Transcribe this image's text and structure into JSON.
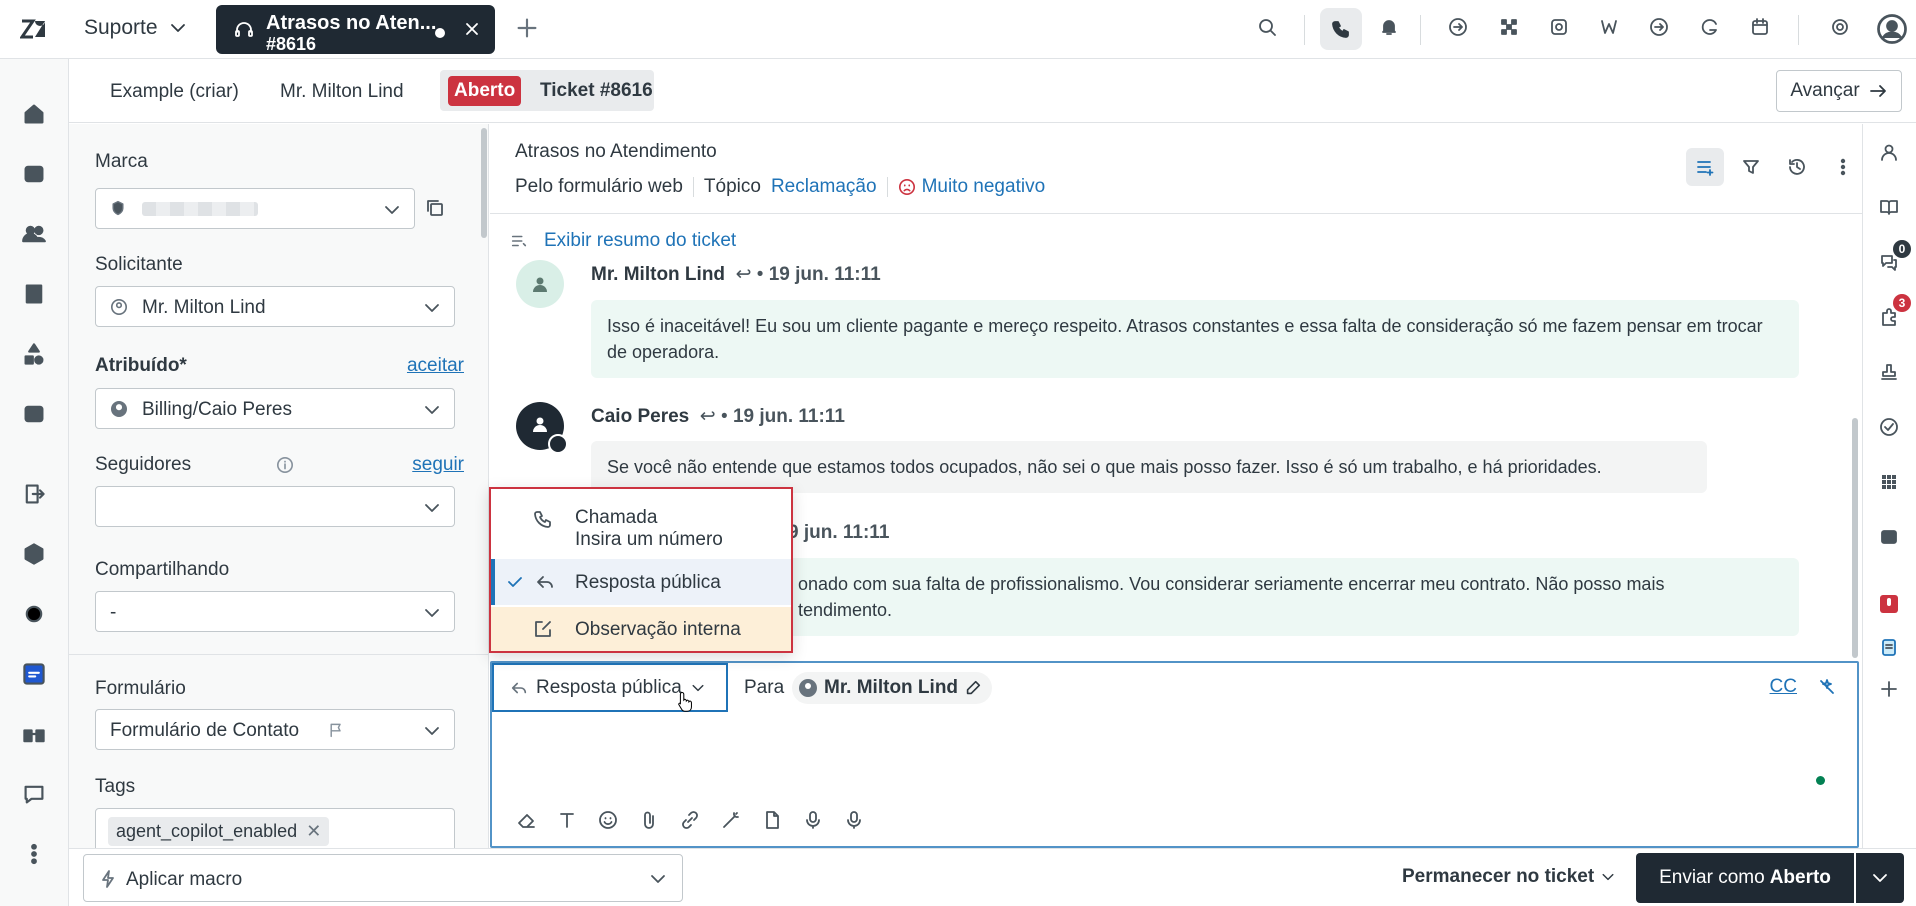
{
  "header": {
    "product": "Suporte",
    "tab": {
      "title": "Atrasos no Aten...",
      "id": "#8616"
    }
  },
  "subheader": {
    "breadcrumbs": [
      "Example (criar)",
      "Mr. Milton Lind"
    ],
    "status_badge": "Aberto",
    "ticket_label": "Ticket #8616",
    "advance_label": "Avançar"
  },
  "properties": {
    "brand_label": "Marca",
    "requester_label": "Solicitante",
    "requester_value": "Mr. Milton Lind",
    "assignee_label": "Atribuído*",
    "assignee_link": "aceitar",
    "assignee_value": "Billing/Caio Peres",
    "followers_label": "Seguidores",
    "followers_link": "seguir",
    "sharing_label": "Compartilhando",
    "sharing_value": "-",
    "form_label": "Formulário",
    "form_value": "Formulário de Contato",
    "tags_label": "Tags",
    "tag": "agent_copilot_enabled"
  },
  "conversation": {
    "title": "Atrasos no Atendimento",
    "via": "Pelo formulário web",
    "topic_label": "Tópico",
    "topic_value": "Reclamação",
    "sentiment": "Muito negativo",
    "summary_link": "Exibir resumo do ticket",
    "messages": [
      {
        "author": "Mr. Milton Lind",
        "time": "19 jun. 11:11",
        "text": "Isso é inaceitável! Eu sou um cliente pagante e mereço respeito. Atrasos constantes e essa falta de consideração só me fazem pensar em trocar de operadora."
      },
      {
        "author": "Caio Peres",
        "time": "19 jun. 11:11",
        "text": "Se você não entende que estamos todos ocupados, não sei o que mais posso fazer. Isso é só um trabalho, e há prioridades."
      },
      {
        "author": "",
        "time": "9 jun. 11:11",
        "text": "onado com sua falta de profissionalismo. Vou considerar seriamente encerrar meu contrato. Não posso mais",
        "text2": "tendimento."
      }
    ]
  },
  "channel_menu": {
    "call_label": "Chamada",
    "call_sub": "Insira um número",
    "public_label": "Resposta pública",
    "internal_label": "Observação interna"
  },
  "composer": {
    "channel": "Resposta pública",
    "to_label": "Para",
    "to_value": "Mr. Milton Lind",
    "cc_label": "CC"
  },
  "rightbar": {
    "badge_chat": "0",
    "badge_apps": "3"
  },
  "footer": {
    "macro_placeholder": "Aplicar macro",
    "stay_label": "Permanecer no ticket",
    "submit_prefix": "Enviar como",
    "submit_status": "Aberto"
  },
  "colors": {
    "accent": "#1f73b7",
    "open_badge": "#cc3340",
    "dark": "#1f2933",
    "internal_note": "#fdefd8",
    "customer_bubble": "#edf8f4"
  }
}
